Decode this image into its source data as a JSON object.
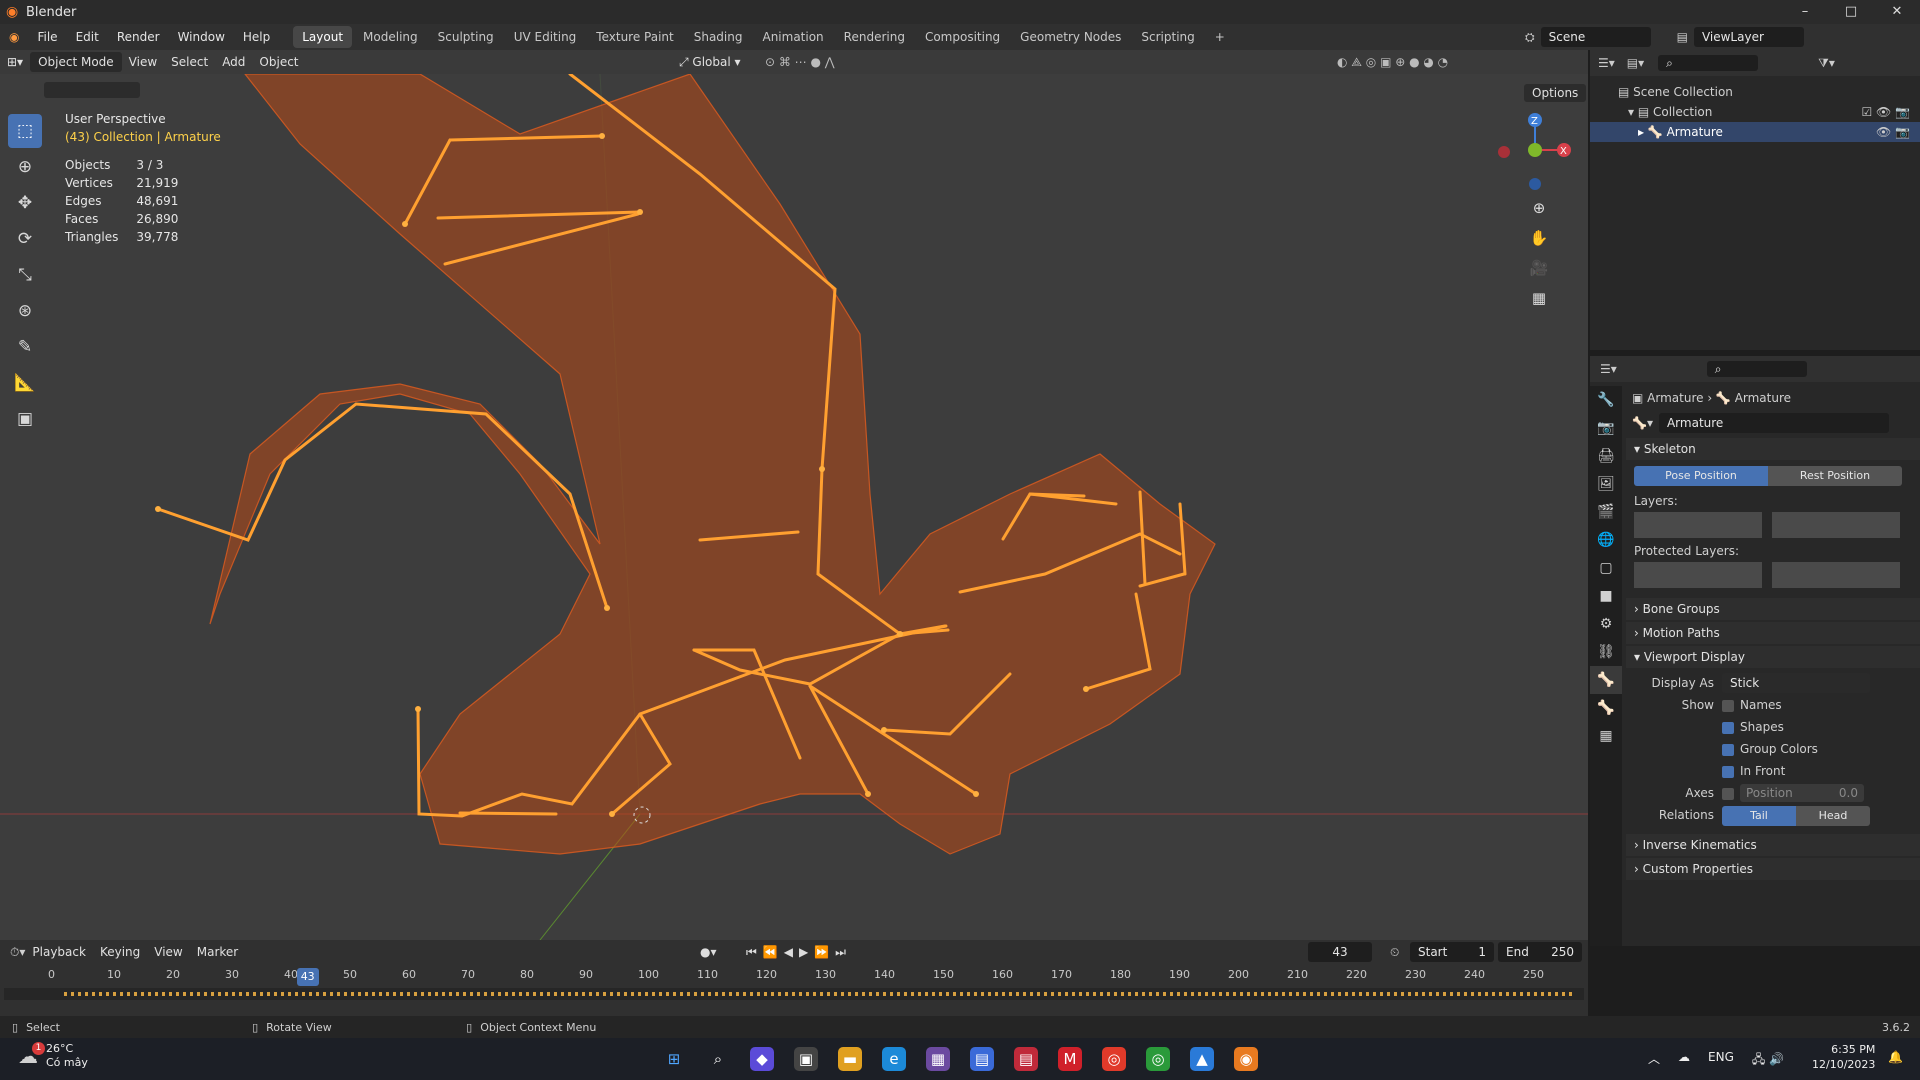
{
  "window": {
    "title": "Blender",
    "controls": [
      "–",
      "□",
      "✕"
    ]
  },
  "menus": [
    "File",
    "Edit",
    "Render",
    "Window",
    "Help"
  ],
  "workspaces": [
    "Layout",
    "Modeling",
    "Sculpting",
    "UV Editing",
    "Texture Paint",
    "Shading",
    "Animation",
    "Rendering",
    "Compositing",
    "Geometry Nodes",
    "Scripting",
    "+"
  ],
  "active_workspace": "Layout",
  "scene": "Scene",
  "view_layer": "ViewLayer",
  "viewport_header": {
    "mode": "Object Mode",
    "menus": [
      "View",
      "Select",
      "Add",
      "Object"
    ],
    "transform": "Global",
    "options": "Options"
  },
  "overlay": {
    "perspective": "User Perspective",
    "collection": "(43) Collection | Armature",
    "stats": [
      {
        "label": "Objects",
        "value": "3 / 3"
      },
      {
        "label": "Vertices",
        "value": "21,919"
      },
      {
        "label": "Edges",
        "value": "48,691"
      },
      {
        "label": "Faces",
        "value": "26,890"
      },
      {
        "label": "Triangles",
        "value": "39,778"
      }
    ]
  },
  "gizmo": {
    "z": "Z",
    "x": "X"
  },
  "outliner": {
    "items": [
      {
        "label": "Scene Collection"
      },
      {
        "label": "Collection"
      },
      {
        "label": "Armature"
      }
    ]
  },
  "properties": {
    "breadcrumb": [
      "Armature",
      "Armature"
    ],
    "data_name": "Armature",
    "skeleton": {
      "title": "Skeleton",
      "pose": "Pose Position",
      "rest": "Rest Position",
      "layers": "Layers:",
      "protected": "Protected Layers:"
    },
    "collapsed": [
      "Bone Groups",
      "Motion Paths"
    ],
    "viewport_display": {
      "title": "Viewport Display",
      "display_as_label": "Display As",
      "display_as": "Stick",
      "show_label": "Show",
      "checks": [
        {
          "label": "Names",
          "on": false
        },
        {
          "label": "Shapes",
          "on": true
        },
        {
          "label": "Group Colors",
          "on": true
        },
        {
          "label": "In Front",
          "on": true
        }
      ],
      "axes_label": "Axes",
      "position_label": "Position",
      "position_value": "0.0",
      "relations_label": "Relations",
      "tail": "Tail",
      "head": "Head"
    },
    "bottom": [
      "Inverse Kinematics",
      "Custom Properties"
    ]
  },
  "timeline": {
    "menus": [
      "Playback",
      "Keying",
      "View",
      "Marker"
    ],
    "current": "43",
    "start_label": "Start",
    "start": "1",
    "end_label": "End",
    "end": "250",
    "ticks": [
      "0",
      "10",
      "20",
      "30",
      "40",
      "50",
      "60",
      "70",
      "80",
      "90",
      "100",
      "110",
      "120",
      "130",
      "140",
      "150",
      "160",
      "170",
      "180",
      "190",
      "200",
      "210",
      "220",
      "230",
      "240",
      "250"
    ]
  },
  "status": {
    "select": "Select",
    "rotate": "Rotate View",
    "context": "Object Context Menu",
    "version": "3.6.2"
  },
  "taskbar": {
    "temp": "26°C",
    "weather": "Có mây",
    "lang": "ENG",
    "time": "6:35 PM",
    "date": "12/10/2023",
    "badge": "1"
  },
  "colors": {
    "accent": "#4772b3",
    "bone": "#ffa030",
    "mesh": "#c2521d"
  }
}
